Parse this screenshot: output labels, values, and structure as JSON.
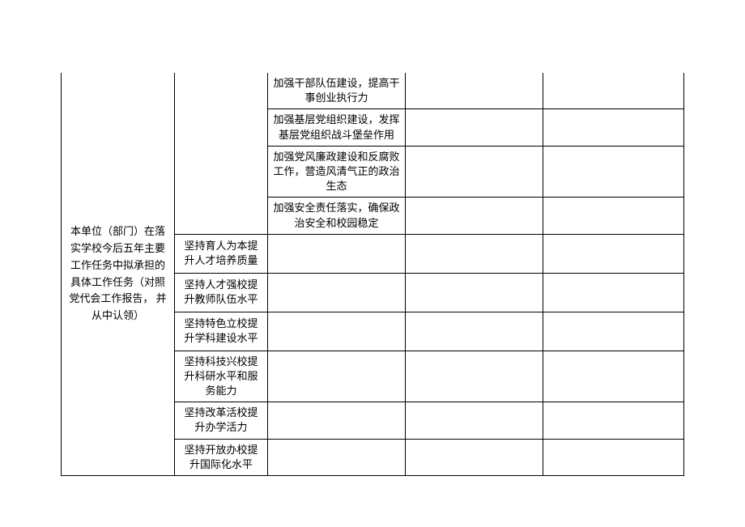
{
  "table": {
    "left_label": "本单位（部门）在落实学校今后五年主要工作任务中拟承担的具体工作任务（对照党代会工作报告，\n并从中认领）",
    "top_group": {
      "r1c3": "加强干部队伍建设，提高干事创业执行力",
      "r2c3": "加强基层党组织建设，发挥基层党组织战斗堡垒作用",
      "r3c3": "加强党风廉政建设和反腐败工作，营造风清气正的政治生态",
      "r4c3": "加强安全责任落实，确保政治安全和校园稳定"
    },
    "bottom_group": {
      "r1c2": "坚持育人为本提升人才培养质量",
      "r2c2": "坚持人才强校提升教师队伍水平",
      "r3c2": "坚持特色立校提升学科建设水平",
      "r4c2": "坚持科技兴校提升科研水平和服务能力",
      "r5c2": "坚持改革活校提升办学活力",
      "r6c2": "坚持开放办校提升国际化水平"
    }
  }
}
